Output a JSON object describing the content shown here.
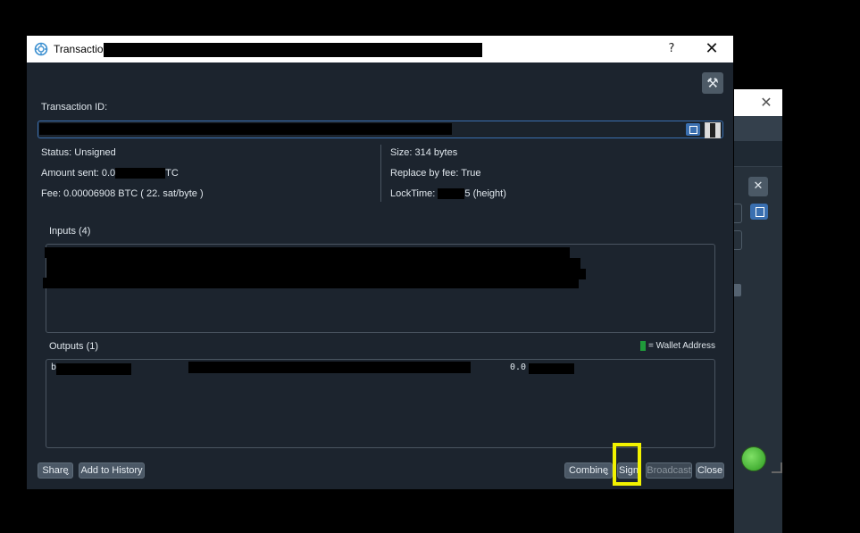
{
  "dialog": {
    "title": "Transactio",
    "help": "?",
    "close": "✕"
  },
  "fields": {
    "txid_label": "Transaction ID:",
    "status": "Status: Unsigned",
    "amount_prefix": "Amount sent: 0.0",
    "amount_suffix": "TC",
    "fee": "Fee: 0.00006908 BTC  ( 22. sat/byte )",
    "size": "Size: 314 bytes",
    "rbf": "Replace by fee: True",
    "locktime_prefix": "LockTime: ",
    "locktime_suffix": "5 (height)"
  },
  "inputs": {
    "label": "Inputs (4)"
  },
  "outputs": {
    "label": "Outputs (1)",
    "legend": "= Wallet Address",
    "row_prefix": "b",
    "row_amount_prefix": "0.0"
  },
  "buttons": {
    "share": "Share",
    "add_history": "Add to History",
    "combine": "Combine",
    "sign": "Sign",
    "broadcast": "Broadcast",
    "close": "Close"
  },
  "background_window": {
    "close": "✕"
  },
  "colors": {
    "accent": "#3a6fb0",
    "highlight": "#f2f200",
    "wallet_green": "#1f9a3a"
  }
}
